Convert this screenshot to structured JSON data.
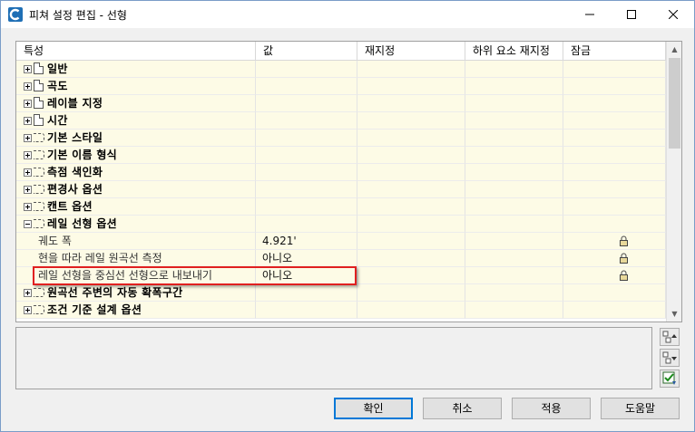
{
  "window": {
    "title": "피쳐 설정 편집 - 선형",
    "icon": "civil3d-app-icon",
    "controls": [
      "minimize-icon",
      "maximize-icon",
      "close-icon"
    ]
  },
  "grid": {
    "columns": [
      "특성",
      "값",
      "재지정",
      "하위 요소 재지정",
      "잠금"
    ],
    "rows": [
      {
        "type": "category",
        "icon": "doc-icon",
        "expander": "plus",
        "label": "일반"
      },
      {
        "type": "category",
        "icon": "doc-icon",
        "expander": "plus",
        "label": "곡도"
      },
      {
        "type": "category",
        "icon": "doc-icon",
        "expander": "plus",
        "label": "레이블 지정"
      },
      {
        "type": "category",
        "icon": "doc-icon",
        "expander": "plus",
        "label": "시간"
      },
      {
        "type": "category",
        "icon": "dashed-icon",
        "expander": "plus",
        "label": "기본 스타일"
      },
      {
        "type": "category",
        "icon": "dashed-icon",
        "expander": "plus",
        "label": "기본 이름 형식"
      },
      {
        "type": "category",
        "icon": "dashed-icon",
        "expander": "plus",
        "label": "측점 색인화"
      },
      {
        "type": "category",
        "icon": "dashed-icon",
        "expander": "plus",
        "label": "편경사 옵션"
      },
      {
        "type": "category",
        "icon": "dashed-icon",
        "expander": "plus",
        "label": "캔트 옵션"
      },
      {
        "type": "category",
        "icon": "dashed-icon",
        "expander": "minus",
        "label": "레일 선형 옵션"
      },
      {
        "type": "property",
        "label": "궤도 폭",
        "value": "4.921'",
        "locked": true
      },
      {
        "type": "property",
        "label": "현을 따라 레일 원곡선 측정",
        "value": "아니오",
        "locked": true
      },
      {
        "type": "property",
        "label": "레일 선형을 중심선 선형으로 내보내기",
        "value": "아니오",
        "locked": true,
        "highlighted": true
      },
      {
        "type": "category",
        "icon": "dashed-icon",
        "expander": "plus",
        "label": "원곡선 주변의 자동 확폭구간"
      },
      {
        "type": "category",
        "icon": "dashed-icon",
        "expander": "plus",
        "label": "조건 기준 설계 옵션"
      }
    ]
  },
  "side_buttons": [
    "expand-all-icon",
    "collapse-all-icon",
    "check-settings-icon"
  ],
  "buttons": {
    "ok": "확인",
    "cancel": "취소",
    "apply": "적용",
    "help": "도움말"
  }
}
